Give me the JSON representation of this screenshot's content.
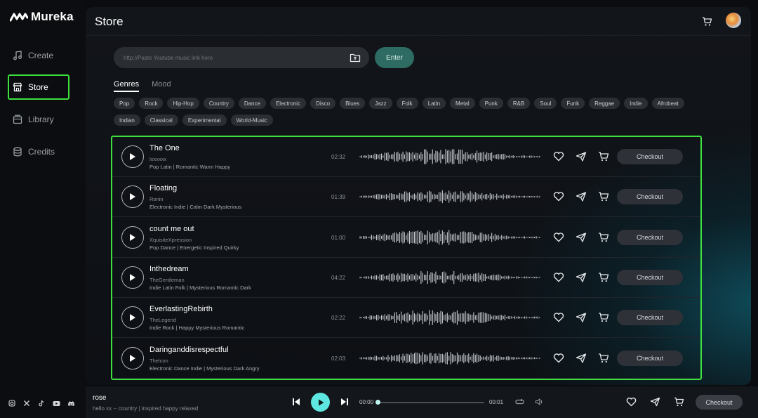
{
  "app": {
    "name": "Mureka"
  },
  "sidebar": {
    "items": [
      {
        "label": "Create",
        "icon": "music-note-icon",
        "active": false
      },
      {
        "label": "Store",
        "icon": "store-icon",
        "active": true
      },
      {
        "label": "Library",
        "icon": "library-icon",
        "active": false
      },
      {
        "label": "Credits",
        "icon": "credits-icon",
        "active": false
      }
    ],
    "socials": [
      "instagram-icon",
      "x-icon",
      "tiktok-icon",
      "youtube-icon",
      "discord-icon"
    ]
  },
  "header": {
    "title": "Store"
  },
  "search": {
    "placeholder": "http://Paste Youtube music link here",
    "enter_label": "Enter"
  },
  "tabs": [
    {
      "label": "Genres",
      "active": true
    },
    {
      "label": "Mood",
      "active": false
    }
  ],
  "genres": [
    "Pop",
    "Rock",
    "Hip-Hop",
    "Country",
    "Dance",
    "Electronic",
    "Disco",
    "Blues",
    "Jazz",
    "Folk",
    "Latin",
    "Metal",
    "Punk",
    "R&B",
    "Soul",
    "Funk",
    "Reggae",
    "Indie",
    "Afrobeat",
    "Indian",
    "Classical",
    "Experimental",
    "World-Music"
  ],
  "tracks": [
    {
      "title": "The One",
      "artist": "lxxxxxx",
      "tags": "Pop Latin | Romantic Warm Happy",
      "duration": "02:32",
      "checkout_label": "Checkout"
    },
    {
      "title": "Floating",
      "artist": "Ronin",
      "tags": "Electronic Indie | Calm Dark Mysterious",
      "duration": "01:39",
      "checkout_label": "Checkout"
    },
    {
      "title": "count me out",
      "artist": "XquisiteXpression",
      "tags": "Pop Dance | Energetic Inspired Quirky",
      "duration": "01:00",
      "checkout_label": "Checkout"
    },
    {
      "title": "Inthedream",
      "artist": "TheGentleman",
      "tags": "Indie Latin Folk | Mysterious Romantic Dark",
      "duration": "04:22",
      "checkout_label": "Checkout"
    },
    {
      "title": "EverlastingRebirth",
      "artist": "TheLegend",
      "tags": "Indie Rock | Happy Mysterious Romantic",
      "duration": "02:22",
      "checkout_label": "Checkout"
    },
    {
      "title": "Daringanddisrespectful",
      "artist": "Thelcon",
      "tags": "Electronic Dance Indie | Mysterious Dark Angry",
      "duration": "02:03",
      "checkout_label": "Checkout"
    }
  ],
  "player": {
    "title": "rose",
    "subtitle": "hello xx -- country | inspired happy relaxed",
    "current_time": "00:00",
    "end_time": "00:01",
    "progress": 0.0,
    "checkout_label": "Checkout"
  },
  "colors": {
    "highlight": "#3ee03e",
    "accent": "#5ee6e0",
    "enter": "#2e6b63"
  }
}
